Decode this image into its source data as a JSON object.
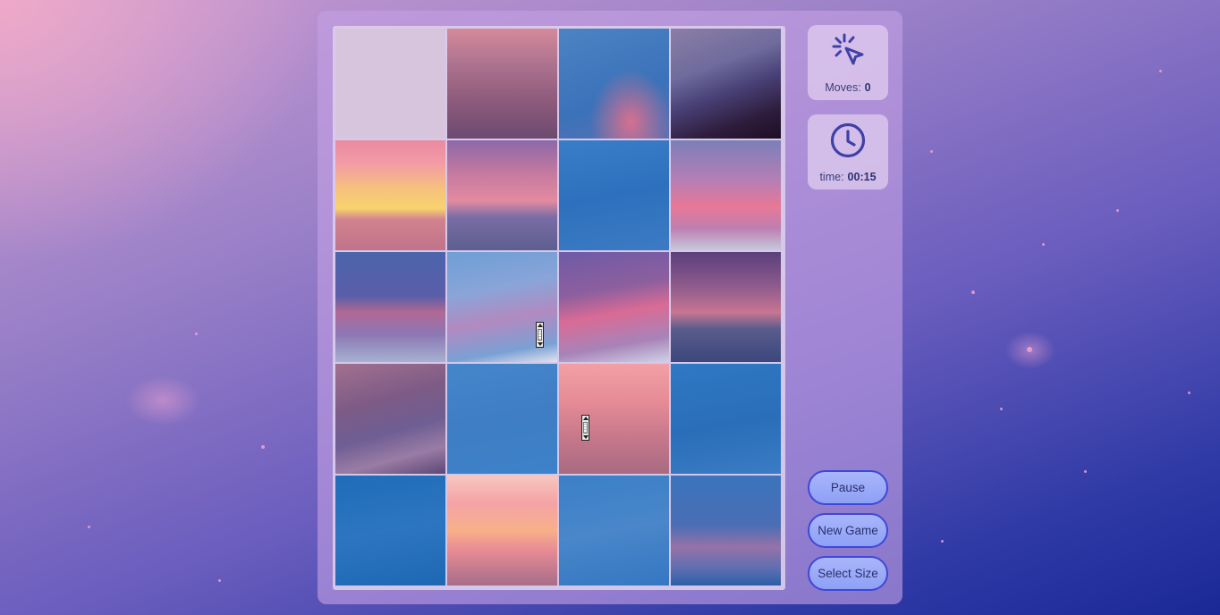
{
  "game": {
    "board": {
      "rows": 5,
      "cols": 4,
      "empty_tile_index": 0,
      "tiles": [
        {
          "index": 0,
          "bg": "#d6c5dc"
        },
        {
          "index": 1,
          "bg": "linear-gradient(180deg,#d48a9a 0%,#b07490 30%,#8e5b7c 65%,#6c4a70 100%)"
        },
        {
          "index": 2,
          "bg": "radial-gradient(ellipse at 65% 85%, #d6708f 0%, rgba(214,112,143,0) 40%), linear-gradient(160deg,#4b83c4 0%,#3b72b9 60%,#5b6fb2 100%)"
        },
        {
          "index": 3,
          "bg": "linear-gradient(160deg,#8b7ea7 0%,#6f6b9c 35%,#4a4379 55%,#2e1c3c 80%,#1e0e24 100%)"
        },
        {
          "index": 4,
          "bg": "linear-gradient(180deg,#ea8aa0 0%,#f39aa7 20%,#f6c27c 45%,#f7d36e 62%,#d2838f 72%,#c0738a 100%)"
        },
        {
          "index": 5,
          "bg": "linear-gradient(180deg,#8c68a8 0%,#c57aa0 30%,#e38ba0 55%,#7a6ca5 70%,#5d5f8f 100%)"
        },
        {
          "index": 6,
          "bg": "linear-gradient(170deg,#3a7dc7 0%,#2d70bd 50%,#3c7bc3 100%)"
        },
        {
          "index": 7,
          "bg": "linear-gradient(180deg,#7b7fb7 0%,#b27fb6 35%,#e87896 60%,#bd7fb0 80%,#c7c9dc 100%)"
        },
        {
          "index": 8,
          "bg": "linear-gradient(180deg,#4b64ad 0%,#5b5ea8 40%,#b16895 55%,#8b78b4 75%,#a6b1d1 100%)"
        },
        {
          "index": 9,
          "bg": "linear-gradient(170deg,#6d9fd6 0%,#8aa4d8 35%,#b18ac0 60%,#7aa0d4 85%,#dfe3ee 100%)"
        },
        {
          "index": 10,
          "bg": "linear-gradient(170deg,#6f5aa7 0%,#8c5f9e 35%,#d96b95 55%,#a783b8 80%,#cfd2e6 100%)"
        },
        {
          "index": 11,
          "bg": "linear-gradient(180deg,#5a3f7c 0%,#8c5a8c 30%,#c77592 55%,#595c8c 70%,#3c477c 100%)"
        },
        {
          "index": 12,
          "bg": "linear-gradient(165deg,#a2708f 0%,#7d5b86 35%,#6e5e93 60%,#9a7ca5 80%,#5d4775 100%)"
        },
        {
          "index": 13,
          "bg": "linear-gradient(170deg,#4586ca 0%,#3f7dc4 50%,#3c82c9 100%)"
        },
        {
          "index": 14,
          "bg": "linear-gradient(180deg,#f2a0a4 0%,#e58b96 35%,#c4768a 70%,#a86b82 100%)"
        },
        {
          "index": 15,
          "bg": "linear-gradient(170deg,#2f78c3 0%,#2a6eb9 55%,#3a7cc4 100%)"
        },
        {
          "index": 16,
          "bg": "linear-gradient(170deg,#1f6cb8 0%,#2d75c0 50%,#1e67b3 100%)"
        },
        {
          "index": 17,
          "bg": "linear-gradient(180deg,#f7c7c0 0%,#f4a3a6 25%,#f7b088 50%,#e88b94 68%,#a66d8a 100%)"
        },
        {
          "index": 18,
          "bg": "linear-gradient(170deg,#3a80c8 0%,#4a86c9 50%,#3477c2 100%)"
        },
        {
          "index": 19,
          "bg": "linear-gradient(180deg,#3a75bd 0%,#4a6db4 45%,#9672a8 65%,#5c6fb0 85%,#2c5ea8 100%)"
        }
      ]
    },
    "stats": {
      "moves_label": "Moves:",
      "moves_value": "0",
      "time_label": "time:",
      "time_value": "00:15"
    },
    "buttons": {
      "pause": "Pause",
      "new_game": "New Game",
      "select_size": "Select Size"
    },
    "colors": {
      "accent": "#3f47d8",
      "button_fill": "#9aaaf8",
      "icon": "#3f40a8"
    },
    "icons": {
      "moves": "click-cursor-icon",
      "time": "clock-icon"
    }
  }
}
